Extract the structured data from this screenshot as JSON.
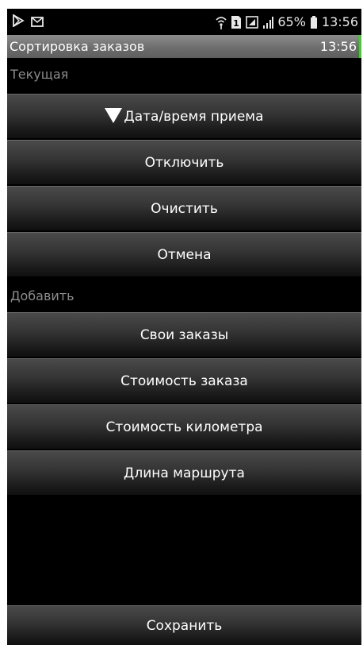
{
  "status_bar": {
    "left_icons": [
      "play-store-icon",
      "mail-icon"
    ],
    "right_icons": [
      "wifi-icon",
      "sim-icon",
      "signal-box-icon",
      "signal-bars-icon",
      "battery-icon"
    ],
    "sim_number": "1",
    "battery": "65%",
    "time": "13:56"
  },
  "title_bar": {
    "title": "Сортировка заказов",
    "clock": "13:56",
    "accent_color": "#39d323"
  },
  "current_section": {
    "label": "Текущая",
    "items": [
      {
        "label": "Дата/время приема",
        "icon": "triangle-down-icon"
      },
      {
        "label": "Отключить"
      },
      {
        "label": "Очистить"
      },
      {
        "label": "Отмена"
      }
    ]
  },
  "add_section": {
    "label": "Добавить",
    "items": [
      {
        "label": "Свои заказы"
      },
      {
        "label": "Стоимость заказа"
      },
      {
        "label": "Стоимость километра"
      },
      {
        "label": "Длина маршрута"
      }
    ]
  },
  "footer": {
    "save_label": "Сохранить"
  }
}
